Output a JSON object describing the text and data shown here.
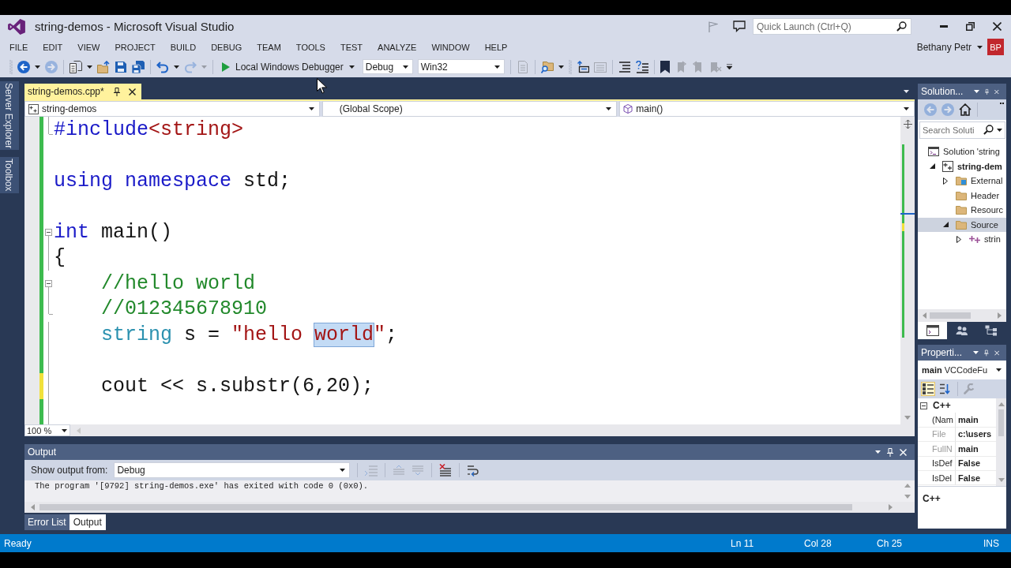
{
  "window": {
    "title": "string-demos - Microsoft Visual Studio",
    "quick_launch": {
      "placeholder": "Quick Launch (Ctrl+Q)"
    },
    "user": {
      "name": "Bethany Petr",
      "initials": "BP"
    }
  },
  "menu": [
    "FILE",
    "EDIT",
    "VIEW",
    "PROJECT",
    "BUILD",
    "DEBUG",
    "TEAM",
    "TOOLS",
    "TEST",
    "ANALYZE",
    "WINDOW",
    "HELP"
  ],
  "toolbar": {
    "buttons": [
      {
        "disabled": false
      },
      {
        "disabled": true
      },
      {
        "disabled": false
      },
      {
        "disabled": false
      },
      {
        "disabled": false
      },
      {
        "disabled": false
      },
      {
        "disabled": false
      },
      {
        "disabled": true
      },
      {
        "disabled": true
      },
      {
        "disabled": false
      },
      {
        "disabled": false
      },
      {
        "disabled": true
      },
      {
        "disabled": false
      },
      {
        "disabled": false
      },
      {
        "disabled": false
      },
      {
        "disabled": true
      },
      {
        "disabled": true
      },
      {
        "disabled": true
      }
    ],
    "debugger": "Local Windows Debugger",
    "configuration": "Debug",
    "platform": "Win32"
  },
  "side_tabs": [
    "Server Explorer",
    "Toolbox"
  ],
  "document_tabs": [
    {
      "label": "string-demos.cpp*",
      "selected": true
    }
  ],
  "navigation": {
    "project": "string-demos",
    "scope": "(Global Scope)",
    "member": "main()"
  },
  "editor": {
    "lines": [
      {
        "kind": "fold-end",
        "saved": true,
        "tokens": [
          {
            "text": "#include",
            "kind": "keyword",
            "selected": false
          },
          {
            "text": "<string>",
            "kind": "string",
            "selected": false
          }
        ]
      },
      {
        "kind": "plain",
        "saved": true
      },
      {
        "kind": "plain",
        "saved": true,
        "tokens": [
          {
            "text": "using",
            "kind": "keyword",
            "selected": false
          },
          {
            "text": " namespace",
            "kind": "keyword",
            "selected": false
          },
          {
            "text": " std;",
            "kind": "plain",
            "selected": false
          }
        ]
      },
      {
        "kind": "plain",
        "saved": true
      },
      {
        "kind": "fold-start",
        "saved": true,
        "tokens": [
          {
            "text": "int",
            "kind": "keyword",
            "selected": false
          },
          {
            "text": " main()",
            "kind": "plain",
            "selected": false
          }
        ]
      },
      {
        "kind": "fold-inside",
        "saved": true,
        "tokens": [
          {
            "text": "{",
            "kind": "plain",
            "selected": false
          }
        ]
      },
      {
        "kind": "fold-start",
        "saved": true,
        "tokens": [
          {
            "text": "    //hello world",
            "kind": "comment",
            "selected": false
          }
        ]
      },
      {
        "kind": "fold-end",
        "saved": true,
        "tokens": [
          {
            "text": "    //012345678910",
            "kind": "comment",
            "selected": false
          }
        ]
      },
      {
        "kind": "fold-inside",
        "saved": true,
        "tokens": [
          {
            "text": "    string",
            "kind": "type",
            "selected": false
          },
          {
            "text": " s = ",
            "kind": "plain",
            "selected": false
          },
          {
            "text": "\"hello ",
            "kind": "string",
            "selected": false
          },
          {
            "text": "world",
            "kind": "string",
            "selected": true
          },
          {
            "text": "\"",
            "kind": "string",
            "selected": false
          },
          {
            "text": ";",
            "kind": "plain",
            "selected": false
          }
        ]
      },
      {
        "kind": "fold-inside",
        "saved": true
      },
      {
        "kind": "fold-inside",
        "saved": false,
        "tokens": [
          {
            "text": "    cout << s.substr(6,20);",
            "kind": "plain",
            "selected": false
          }
        ]
      },
      {
        "kind": "fold-inside",
        "saved": true
      }
    ],
    "zoom": "100 %"
  },
  "output": {
    "title": "Output",
    "source_label": "Show output from:",
    "source": "Debug",
    "tools": [
      {
        "disabled": true
      },
      {
        "disabled": true
      },
      {
        "disabled": true
      },
      {
        "disabled": false
      },
      {
        "disabled": false
      }
    ],
    "text": "The program '[9792] string-demos.exe' has exited with code 0 (0x0)."
  },
  "panel_tabs": [
    {
      "label": "Error List",
      "selected": false
    },
    {
      "label": "Output",
      "selected": true
    }
  ],
  "solution_explorer": {
    "title": "Solution...",
    "tools": [
      {
        "disabled": true
      },
      {
        "disabled": true
      },
      {
        "disabled": false
      }
    ],
    "search": {
      "placeholder": "Search Soluti"
    },
    "tree": [
      {
        "label": "Solution 'string",
        "kind": "solution",
        "selected": false,
        "children": [
          {
            "label": "string-dem",
            "kind": "project",
            "selected": false,
            "expanded": true,
            "children": [
              {
                "label": "External",
                "kind": "dependencies",
                "selected": false,
                "expanded": false
              },
              {
                "label": "Header",
                "kind": "folder",
                "selected": false
              },
              {
                "label": "Resourc",
                "kind": "folder",
                "selected": false
              },
              {
                "label": "Source",
                "kind": "folder",
                "selected": true,
                "expanded": true,
                "children": [
                  {
                    "label": "strin",
                    "kind": "file",
                    "selected": false,
                    "expanded": false
                  }
                ]
              }
            ]
          }
        ]
      }
    ],
    "tabs": [
      {
        "selected": true
      },
      {
        "selected": false
      },
      {
        "selected": false
      }
    ]
  },
  "properties": {
    "title": "Properti...",
    "object": {
      "name": "main",
      "type": "VCCodeFu"
    },
    "view_buttons": [
      {
        "selected": true
      },
      {
        "selected": false
      }
    ],
    "pages_button": {
      "disabled": true
    },
    "categories": [
      {
        "label": "C++",
        "expanded": true,
        "rows": [
          {
            "name": "(Nam",
            "value": "main",
            "readonly": false
          },
          {
            "name": "File",
            "value": "c:\\users",
            "readonly": true
          },
          {
            "name": "FullN",
            "value": "main",
            "readonly": true
          },
          {
            "name": "IsDef",
            "value": "False",
            "readonly": false
          },
          {
            "name": "IsDel",
            "value": "False",
            "readonly": false
          }
        ]
      }
    ],
    "description": "C++"
  },
  "status_bar": {
    "message": "Ready",
    "line": "Ln 11",
    "column": "Col 28",
    "character": "Ch 25",
    "mode": "INS"
  }
}
